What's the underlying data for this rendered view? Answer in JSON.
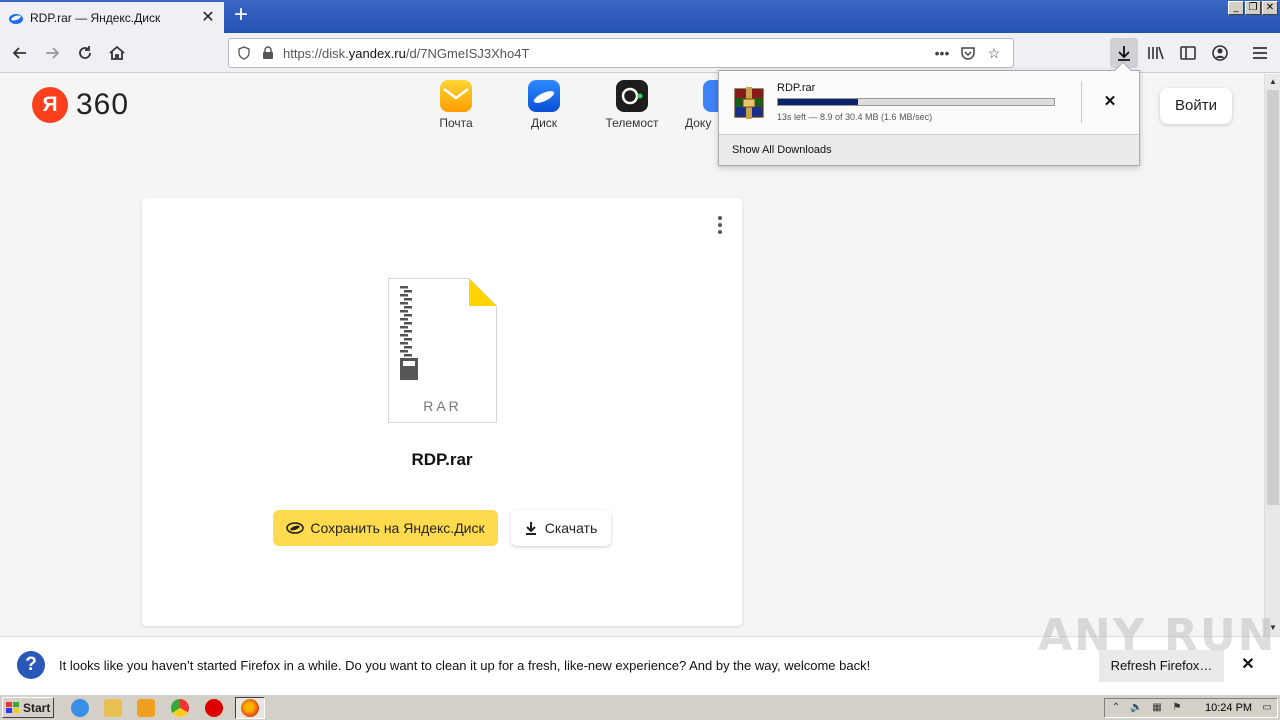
{
  "browser": {
    "tab_title": "RDP.rar — Яндекс.Диск",
    "tab_close": "✕",
    "new_tab": "+",
    "url_prefix": "https://disk.",
    "url_domain": "yandex.ru",
    "url_path": "/d/7NGmeISJ3Xho4T",
    "window_buttons": [
      "_",
      "❐",
      "✕"
    ]
  },
  "header": {
    "logo_letter": "Я",
    "logo_text": "360",
    "apps": [
      {
        "label": "Почта",
        "color": "#ffb800"
      },
      {
        "label": "Диск",
        "color": "#1a6cf0"
      },
      {
        "label": "Телемост",
        "color": "#1d1d1d"
      },
      {
        "label": "Доку",
        "color": "#3d82f7"
      }
    ],
    "login_label": "Войти"
  },
  "file": {
    "type_label": "RAR",
    "name": "RDP.rar",
    "save_label": "Сохранить на Яндекс.Диск",
    "download_label": "Скачать"
  },
  "downloads_panel": {
    "filename": "RDP.rar",
    "progress": 0.29,
    "status": "13s left — 8.9 of 30.4 MB (1.6 MB/sec)",
    "show_all": "Show All Downloads",
    "cancel": "✕"
  },
  "notification": {
    "message": "It looks like you haven’t started Firefox in a while. Do you want to clean it up for a fresh, like-new experience? And by the way, welcome back!",
    "refresh_label": "Refresh Firefox…",
    "close": "✕",
    "icon": "?"
  },
  "watermark": "ANY RUN",
  "taskbar": {
    "start_label": "Start",
    "clock": "10:24 PM"
  }
}
